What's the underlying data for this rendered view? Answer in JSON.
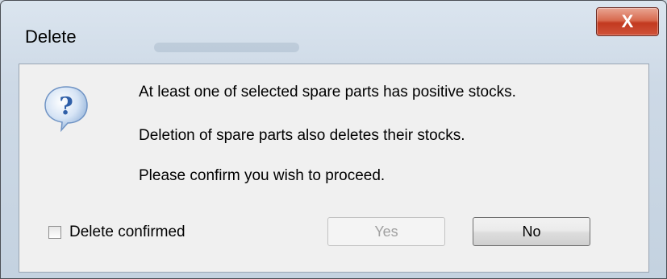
{
  "window": {
    "title": "Delete",
    "close_label": "X"
  },
  "dialog": {
    "icon": "question-icon",
    "messages": [
      "At least one of selected spare parts has positive stocks.",
      "Deletion of spare parts also deletes their stocks.",
      "Please confirm you wish to proceed."
    ],
    "checkbox": {
      "label": "Delete confirmed",
      "checked": false
    },
    "buttons": {
      "yes_label": "Yes",
      "yes_enabled": false,
      "no_label": "No"
    }
  },
  "colors": {
    "close_button": "#c2391f",
    "question_icon": "#2f5fa8"
  }
}
